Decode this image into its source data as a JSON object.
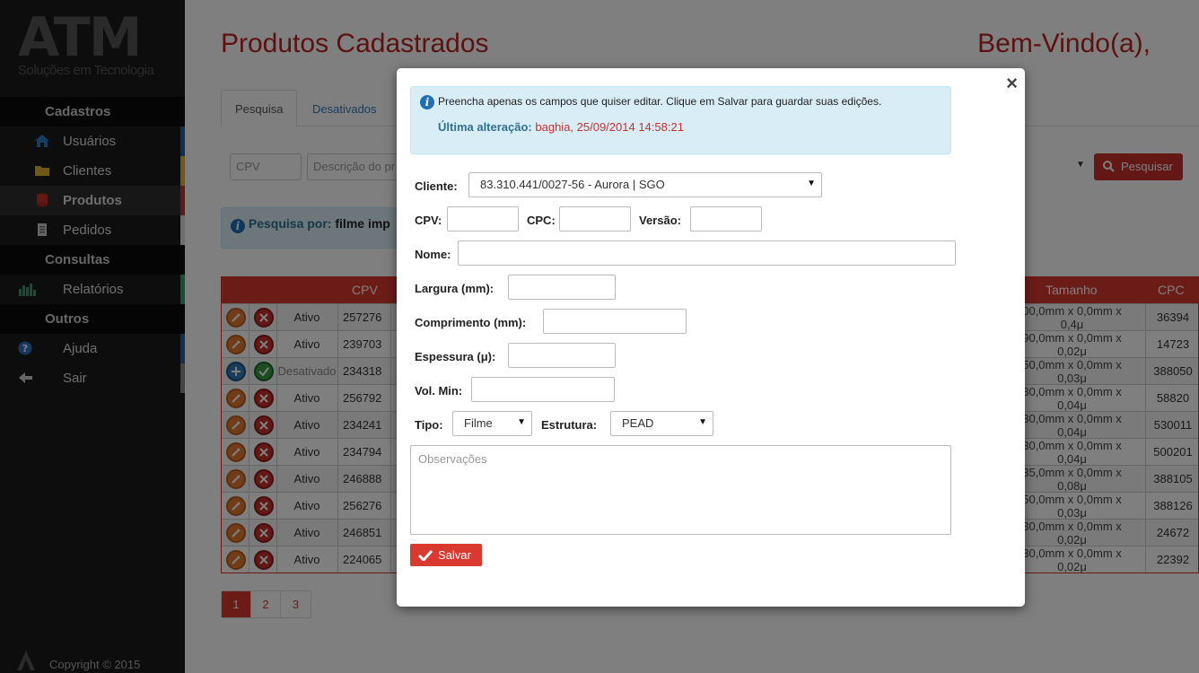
{
  "sidebar": {
    "logo_mark": "ATM",
    "logo_sub": "Soluções em Tecnologia",
    "sections": [
      {
        "title": "Cadastros"
      },
      {
        "title": "Consultas"
      },
      {
        "title": "Outros"
      }
    ],
    "items": [
      {
        "label": "Usuários",
        "icon": "home-icon",
        "bar": "#1f5fa8"
      },
      {
        "label": "Clientes",
        "icon": "folder-icon",
        "bar": "#e0b02a"
      },
      {
        "label": "Produtos",
        "icon": "database-icon",
        "bar": "#c9302c"
      },
      {
        "label": "Pedidos",
        "icon": "document-icon",
        "bar": "#dddddd"
      },
      {
        "label": "Relatórios",
        "icon": "chart-icon",
        "bar": "#2aa06b"
      },
      {
        "label": "Ajuda",
        "icon": "help-icon",
        "bar": "#1f5fa8"
      },
      {
        "label": "Sair",
        "icon": "arrow-left-icon",
        "bar": "#888888"
      }
    ],
    "copyright": "Copyright © 2015"
  },
  "main": {
    "title": "Produtos Cadastrados",
    "welcome": "Bem-Vindo(a),",
    "tabs": [
      {
        "label": "Pesquisa"
      },
      {
        "label": "Desativados"
      }
    ],
    "filter": {
      "cpv_placeholder": "CPV",
      "desc_placeholder": "Descrição do pr",
      "search_label": "Pesquisar"
    },
    "search_info": {
      "prefix": "Pesquisa por:",
      "term": "filme imp"
    },
    "table": {
      "headers": {
        "cpv": "CPV",
        "tamanho": "Tamanho",
        "cpc": "CPC"
      },
      "rows": [
        {
          "status": "Ativo",
          "cpv": "257276",
          "tam1": "00,0mm x 0,0mm x",
          "tam2": "0,4μ",
          "cpc": "36394"
        },
        {
          "status": "Ativo",
          "cpv": "239703",
          "tam1": "90,0mm x 0,0mm x",
          "tam2": "0,02μ",
          "cpc": "14723"
        },
        {
          "status": "Desativado",
          "cpv": "234318",
          "tam1": "50,0mm x 0,0mm x",
          "tam2": "0,03μ",
          "cpc": "388050"
        },
        {
          "status": "Ativo",
          "cpv": "256792",
          "tam1": "30,0mm x 0,0mm x",
          "tam2": "0,04μ",
          "cpc": "58820"
        },
        {
          "status": "Ativo",
          "cpv": "234241",
          "tam1": "30,0mm x 0,0mm x",
          "tam2": "0,04μ",
          "cpc": "530011"
        },
        {
          "status": "Ativo",
          "cpv": "234794",
          "tam1": "30,0mm x 0,0mm x",
          "tam2": "0,04μ",
          "cpc": "500201"
        },
        {
          "status": "Ativo",
          "cpv": "246888",
          "tam1": "35,0mm x 0,0mm x",
          "tam2": "0,08μ",
          "cpc": "388105"
        },
        {
          "status": "Ativo",
          "cpv": "256276",
          "tam1": "50,0mm x 0,0mm x",
          "tam2": "0,03μ",
          "cpc": "388126"
        },
        {
          "status": "Ativo",
          "cpv": "246851",
          "tam1": "30,0mm x 0,0mm x",
          "tam2": "0,02μ",
          "cpc": "24672"
        },
        {
          "status": "Ativo",
          "cpv": "224065",
          "tam1": "30,0mm x 0,0mm x",
          "tam2": "0,02μ",
          "cpc": "22392"
        }
      ]
    },
    "pager": [
      "1",
      "2",
      "3"
    ]
  },
  "modal": {
    "close": "×",
    "info_text": "Preencha apenas os campos que quiser editar. Clique em Salvar para guardar suas edições.",
    "last_change_label": "Última alteração:",
    "last_change_value": "baghia, 25/09/2014 14:58:21",
    "fields": {
      "cliente_label": "Cliente:",
      "cliente_value": "83.310.441/0027-56 - Aurora | SGO",
      "cpv_label": "CPV:",
      "cpc_label": "CPC:",
      "versao_label": "Versão:",
      "nome_label": "Nome:",
      "largura_label": "Largura (mm):",
      "comprimento_label": "Comprimento (mm):",
      "espessura_label": "Espessura (μ):",
      "volmin_label": "Vol. Min:",
      "tipo_label": "Tipo:",
      "tipo_value": "Filme",
      "estrutura_label": "Estrutura:",
      "estrutura_value": "PEAD",
      "obs_placeholder": "Observações"
    },
    "save_label": "Salvar"
  }
}
